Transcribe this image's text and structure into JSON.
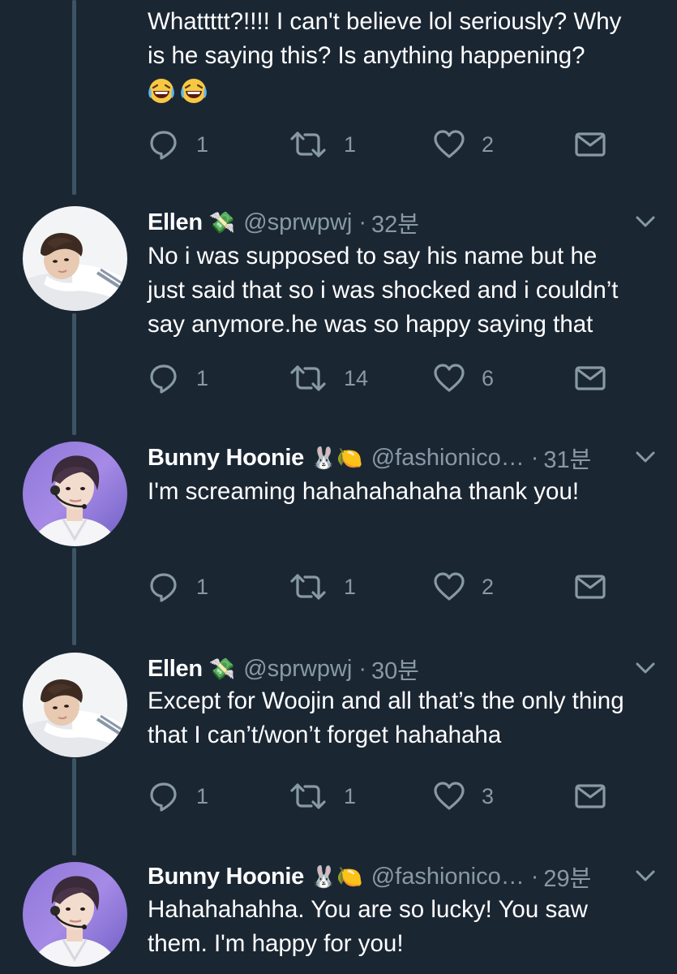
{
  "colors": {
    "background": "#1b2633",
    "text": "#ffffff",
    "secondary": "#8899a6",
    "thread_line": "#3d5466"
  },
  "icons": {
    "reply": "reply-icon",
    "retweet": "retweet-icon",
    "like": "heart-icon",
    "dm": "envelope-icon",
    "more": "chevron-down-icon"
  },
  "tweets": [
    {
      "text_lines": [
        "Whattttt?!!!! I can't believe lol seriously? Why",
        "is he saying this? Is anything happening?"
      ],
      "emojis": "😂😂",
      "replies": "1",
      "retweets": "1",
      "likes": "2"
    },
    {
      "name": "Ellen",
      "name_emoji": "💸",
      "handle": "@sprwpwj",
      "time": "32분",
      "text_lines": [
        "No i was supposed to say his name but he",
        "just said that so i was shocked and i couldn’t",
        "say anymore.he was so happy saying that"
      ],
      "replies": "1",
      "retweets": "14",
      "likes": "6"
    },
    {
      "name": "Bunny Hoonie",
      "name_emoji": "🐰🍋",
      "handle": "@fashionico…",
      "time": "31분",
      "text_lines": [
        "I'm screaming hahahahahaha thank you!"
      ],
      "replies": "1",
      "retweets": "1",
      "likes": "2"
    },
    {
      "name": "Ellen",
      "name_emoji": "💸",
      "handle": "@sprwpwj",
      "time": "30분",
      "text_lines": [
        "Except for Woojin and all that’s the only thing",
        "that I can’t/won’t forget hahahaha"
      ],
      "replies": "1",
      "retweets": "1",
      "likes": "3"
    },
    {
      "name": "Bunny Hoonie",
      "name_emoji": "🐰🍋",
      "handle": "@fashionico…",
      "time": "29분",
      "text_lines": [
        "Hahahahahha. You are so lucky! You saw",
        "them. I'm happy for you!"
      ]
    }
  ]
}
